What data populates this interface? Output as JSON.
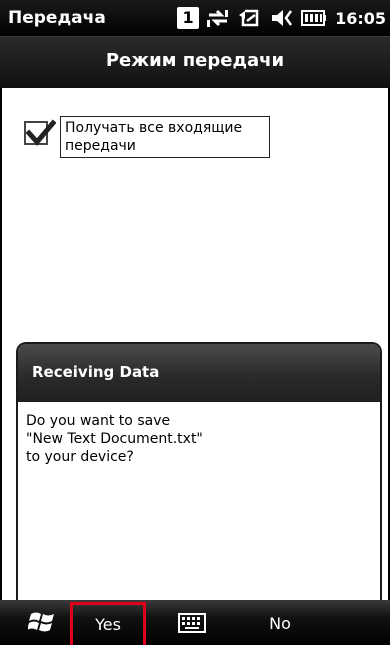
{
  "statusbar": {
    "app_title": "Передача",
    "notification_count": "1",
    "time": "16:05",
    "icons": [
      "connectivity-icon",
      "sync-icon",
      "volume-muted-icon",
      "battery-icon"
    ]
  },
  "titlebar": {
    "title": "Режим передачи"
  },
  "settings": {
    "receive_all_label": "Получать все входящие передачи",
    "receive_all_checked": true
  },
  "dialog": {
    "title": "Receiving Data",
    "message_line1": "Do you want to save",
    "message_line2": "\"New Text Document.txt\"",
    "message_line3": "to your device?"
  },
  "bottombar": {
    "yes_label": "Yes",
    "no_label": "No",
    "highlight_color": "#e0001b",
    "icons": [
      "windows-start-icon",
      "keyboard-icon"
    ]
  }
}
